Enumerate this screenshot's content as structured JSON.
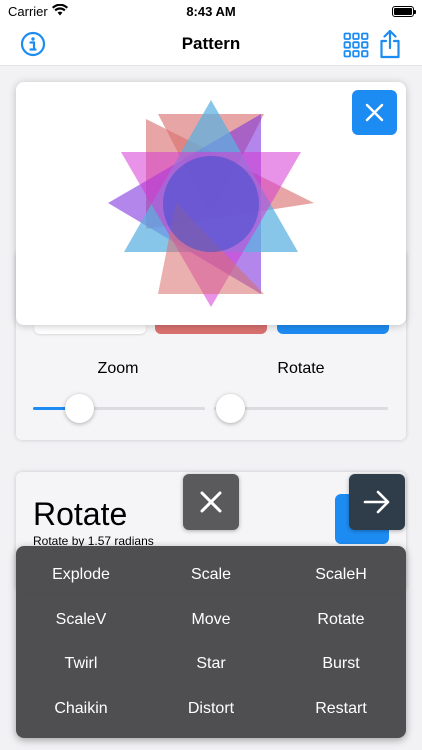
{
  "status_bar": {
    "carrier": "Carrier",
    "time": "8:43 AM"
  },
  "nav": {
    "title": "Pattern",
    "left_icon": "info-icon",
    "right_icons": [
      "grid-icon",
      "share-icon"
    ]
  },
  "colors": {
    "accent": "#1d8cf2",
    "menu_bg": "#474749",
    "red": "#d9706e",
    "purple": "#8a2be2",
    "magenta": "#d63ad3",
    "sky": "#5ab0e0"
  },
  "controls": {
    "zoom_label": "Zoom",
    "rotate_label": "Rotate",
    "zoom_value": 0.27,
    "rotate_value": 0.0
  },
  "selected": {
    "title": "Rotate",
    "subtitle": "Rotate by 1.57 radians"
  },
  "menu": {
    "items": [
      {
        "label": "Explode"
      },
      {
        "label": "Scale"
      },
      {
        "label": "ScaleH"
      },
      {
        "label": "ScaleV"
      },
      {
        "label": "Move"
      },
      {
        "label": "Rotate"
      },
      {
        "label": "Twirl"
      },
      {
        "label": "Star"
      },
      {
        "label": "Burst"
      },
      {
        "label": "Chaikin"
      },
      {
        "label": "Distort"
      },
      {
        "label": "Restart"
      }
    ]
  }
}
